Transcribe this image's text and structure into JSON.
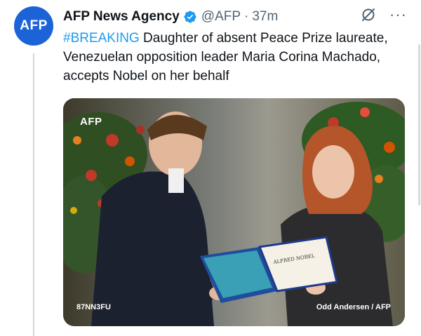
{
  "tweet": {
    "avatar_text": "AFP",
    "author_name": "AFP News Agency",
    "handle": "@AFP",
    "separator": "·",
    "time": "37m",
    "more_label": "···",
    "hashtag": "#BREAKING",
    "body": " Daughter of absent Peace Prize laureate, Venezuelan opposition leader Maria Corina Machado, accepts Nobel on her behalf",
    "icons": {
      "verified": "verified-badge-icon",
      "grok": "grok-icon",
      "more": "more-icon"
    },
    "brand_color": "#1d63d8",
    "verified_color": "#1d9bf0"
  },
  "media": {
    "watermark": "AFP",
    "caption_left": "87NN3FU",
    "credit": "Odd Andersen / AFP",
    "diploma_text": "ALFRED NOBEL"
  }
}
